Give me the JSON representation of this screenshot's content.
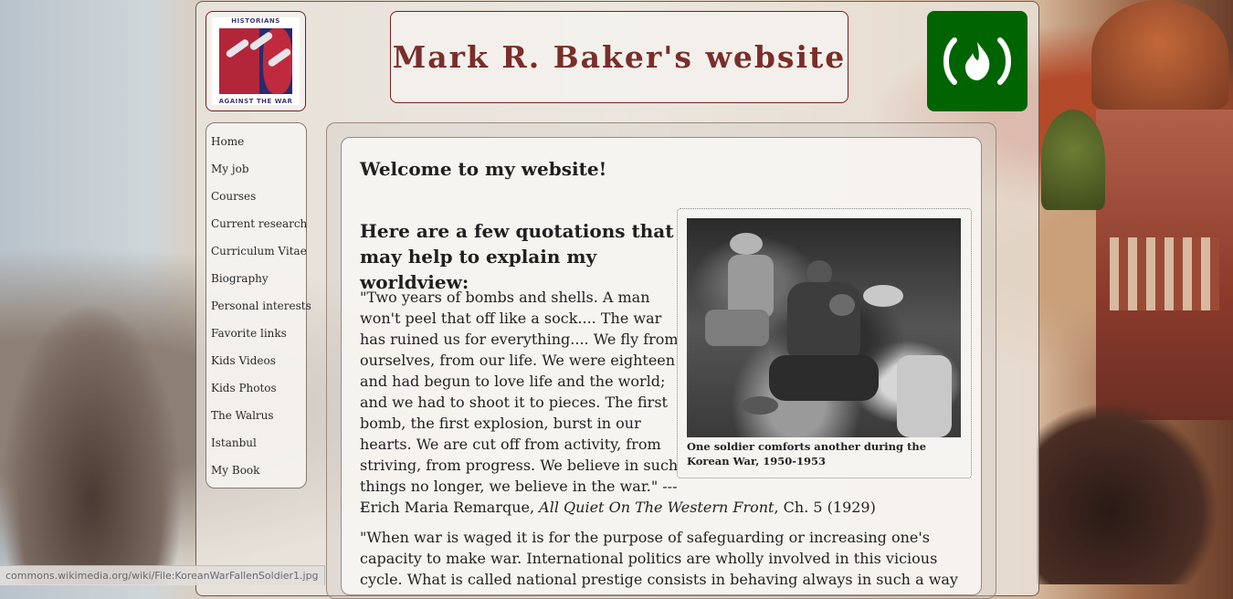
{
  "header": {
    "logo_top": "HISTORIANS",
    "logo_bottom": "AGAINST THE WAR",
    "site_title": "Mark R. Baker's website",
    "badge_icon": "flame-in-parentheses-icon",
    "badge_color": "#006400"
  },
  "nav": {
    "items": [
      {
        "label": "Home"
      },
      {
        "label": "My job"
      },
      {
        "label": "Courses"
      },
      {
        "label": "Current research"
      },
      {
        "label": "Curriculum Vitae"
      },
      {
        "label": "Biography"
      },
      {
        "label": "Personal interests"
      },
      {
        "label": "Favorite links"
      },
      {
        "label": "Kids Videos"
      },
      {
        "label": "Kids Photos"
      },
      {
        "label": "The Walrus"
      },
      {
        "label": "Istanbul"
      },
      {
        "label": "My Book"
      }
    ]
  },
  "main": {
    "welcome": "Welcome to my website!",
    "quotes_heading": "Here are a few quotations that may help to explain my worldview:",
    "quote1_text": "\"Two years of bombs and shells. A man won't peel that off like a sock.... The war has ruined us for everything.... We fly from ourselves, from our life. We were eighteen and had begun to love life and the world; and we had to shoot it to pieces. The first bomb, the first explosion, burst in our hearts. We are cut off from activity, from striving, from progress. We believe in such things no longer, we believe in the war.\" ----",
    "quote1_author": "Erich Maria Remarque, ",
    "quote1_book": "All Quiet On The Western Front",
    "quote1_ref": ", Ch. 5 (1929)",
    "quote2_text": "\"When war is waged it is for the purpose of safeguarding or increasing one's capacity to make war. International politics are wholly involved in this vicious cycle. What is called national prestige consists in behaving always in such a way as to",
    "photo_caption": "One soldier comforts another during the Korean War, 1950-1953"
  },
  "status": {
    "url": "commons.wikimedia.org/wiki/File:KoreanWarFallenSoldier1.jpg"
  }
}
